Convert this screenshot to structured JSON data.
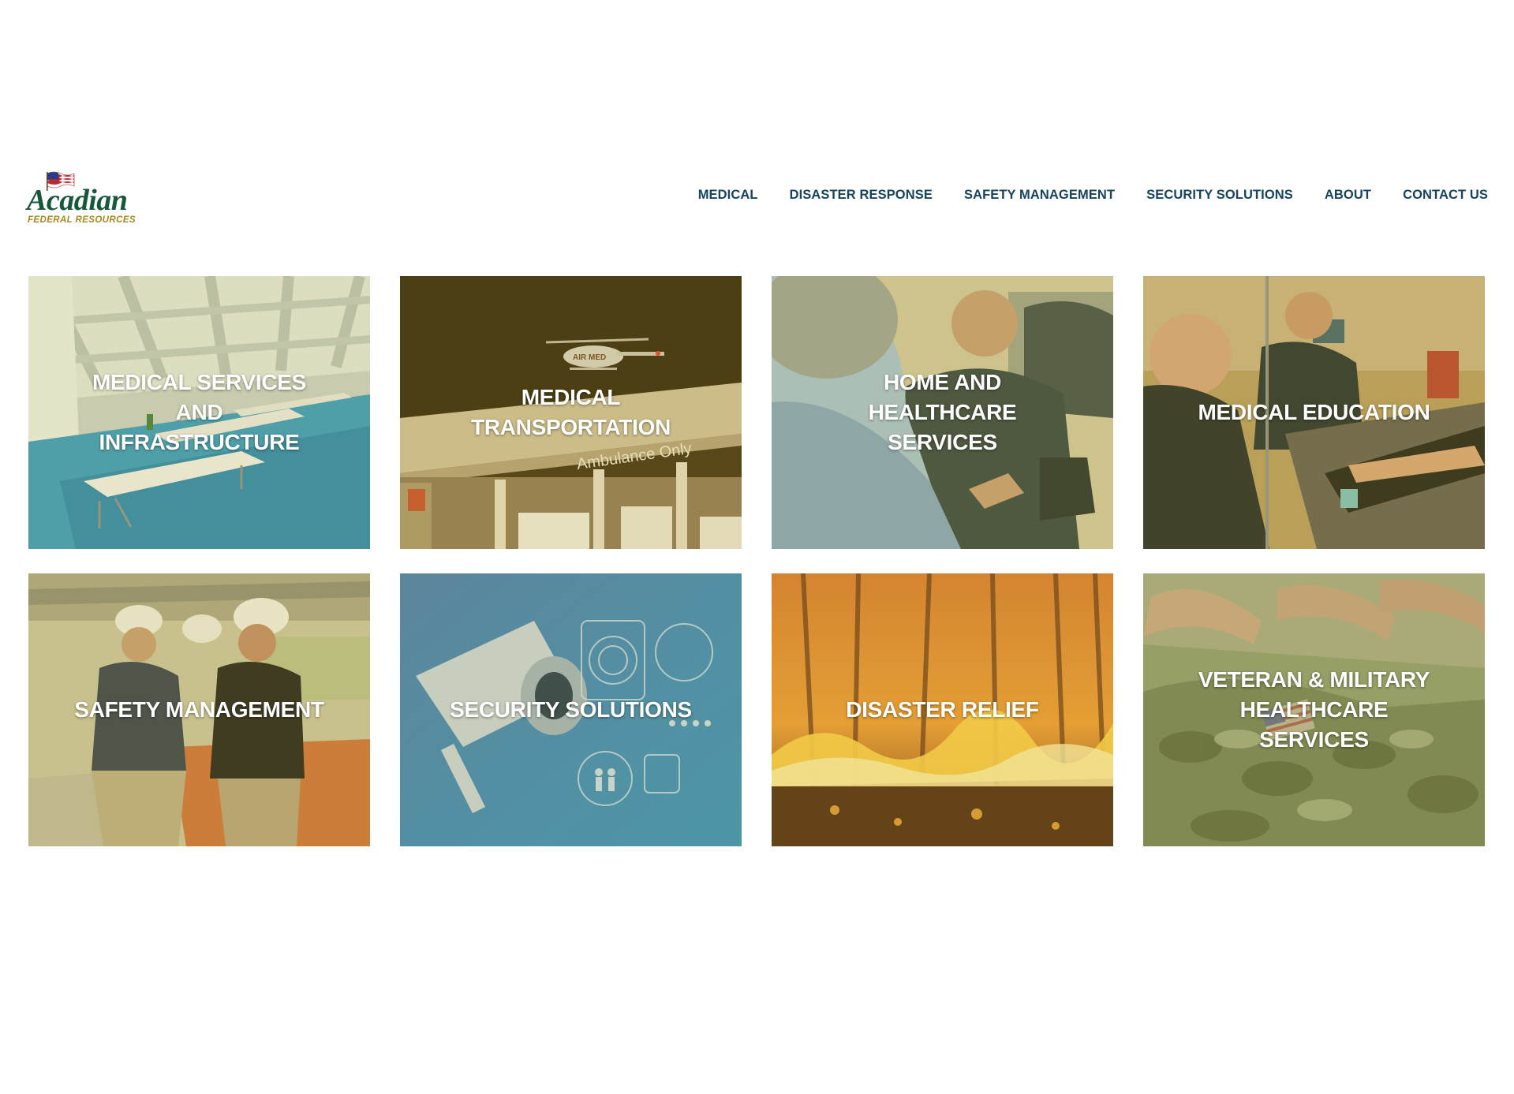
{
  "brand": {
    "name": "Acadian",
    "tagline": "FEDERAL RESOURCES",
    "colors": {
      "green": "#15583a",
      "gold": "#a8891d",
      "nav": "#16435e"
    }
  },
  "nav": {
    "items": [
      {
        "label": "MEDICAL"
      },
      {
        "label": "DISASTER RESPONSE"
      },
      {
        "label": "SAFETY MANAGEMENT"
      },
      {
        "label": "SECURITY SOLUTIONS"
      },
      {
        "label": "ABOUT"
      },
      {
        "label": "CONTACT US"
      }
    ]
  },
  "tiles": [
    {
      "label": "MEDICAL SERVICES AND INFRASTRUCTURE",
      "image": "field-hospital-tent"
    },
    {
      "label": "MEDICAL TRANSPORTATION",
      "image": "air-ambulance-bay",
      "photo_text": [
        "AIR MED",
        "Ambulance Only"
      ]
    },
    {
      "label": "HOME AND HEALTHCARE SERVICES",
      "image": "paramedic-home-visit"
    },
    {
      "label": "MEDICAL EDUCATION",
      "image": "iv-training-class"
    },
    {
      "label": "SAFETY MANAGEMENT",
      "image": "hardhat-safety-inspection"
    },
    {
      "label": "SECURITY SOLUTIONS",
      "image": "cctv-security-graphic"
    },
    {
      "label": "DISASTER RELIEF",
      "image": "forest-wildfire"
    },
    {
      "label": "VETERAN & MILITARY HEALTHCARE SERVICES",
      "image": "military-salute"
    }
  ]
}
